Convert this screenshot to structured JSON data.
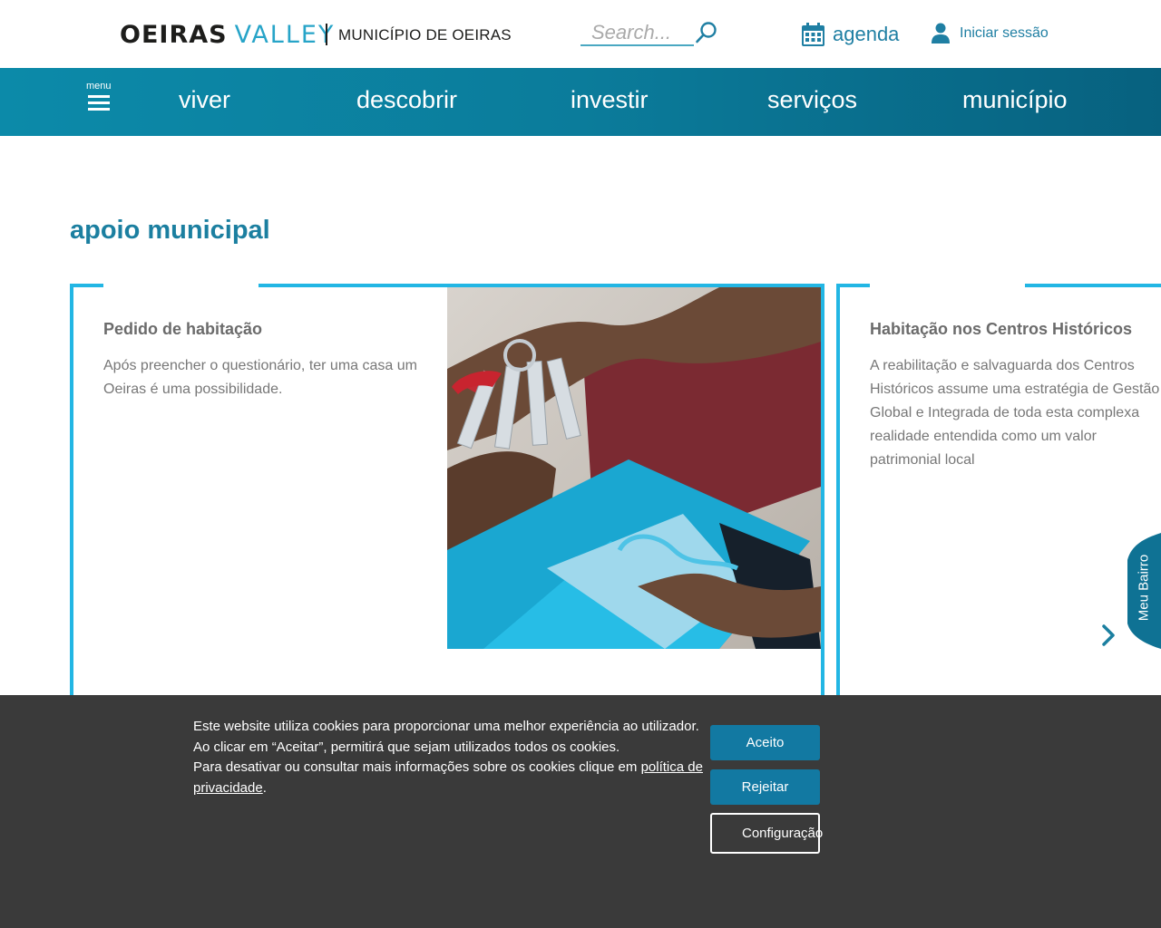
{
  "header": {
    "logo_oeiras": "OEIRAS",
    "logo_valley": "VALLEY",
    "municipio": "MUNICÍPIO DE OEIRAS",
    "search_placeholder": "Search...",
    "agenda_label": "agenda",
    "login_label": "Iniciar sessão"
  },
  "nav": {
    "menu_label": "menu",
    "items": [
      "viver",
      "descobrir",
      "investir",
      "serviços",
      "município"
    ]
  },
  "main": {
    "section_title": "apoio municipal",
    "cards": [
      {
        "title": "Pedido de habitação",
        "text": "Após preencher o questionário, ter uma casa um Oeiras é uma possibilidade."
      },
      {
        "title": "Habitação nos Centros Históricos",
        "text": "A reabilitação e salvaguarda dos Centros Históricos assume uma estratégia de Gestão Global e Integrada de toda esta complexa realidade entendida como um valor patrimonial local"
      }
    ],
    "side_tab": "Meu Bairro"
  },
  "cookie": {
    "line1": "Este website utiliza cookies para proporcionar uma melhor experiência ao utilizador.",
    "line2": "Ao clicar em “Aceitar”, permitirá que sejam utilizados todos os cookies.",
    "line3_prefix": "Para desativar ou consultar mais informações sobre os cookies clique em ",
    "link": "política de privacidade",
    "line3_suffix": ".",
    "accept": "Aceito",
    "reject": "Rejeitar",
    "settings": "Configuração"
  },
  "colors": {
    "accent": "#1b7fa0",
    "card_border": "#22b6e4",
    "nav_start": "#0c8aa9",
    "nav_end": "#07617f",
    "cookie_bg": "#3a3a3a",
    "button": "#1279a2"
  },
  "icons": [
    "search-icon",
    "calendar-icon",
    "user-icon",
    "menu-icon",
    "chevron-right-icon"
  ]
}
